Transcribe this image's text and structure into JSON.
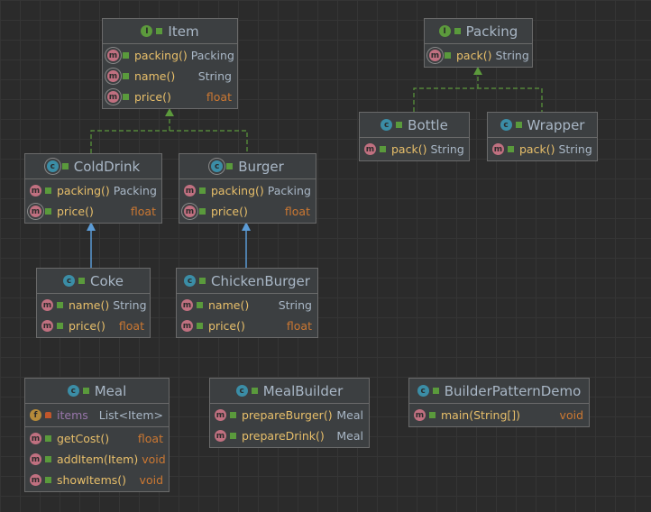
{
  "classes": [
    {
      "id": "item",
      "name": "Item",
      "kind": "I",
      "fields": [],
      "methods": [
        {
          "name": "packing()",
          "type": "Packing",
          "abstract": true
        },
        {
          "name": "name()",
          "type": "String",
          "abstract": true
        },
        {
          "name": "price()",
          "type": "float",
          "abstract": true
        }
      ]
    },
    {
      "id": "packing",
      "name": "Packing",
      "kind": "I",
      "fields": [],
      "methods": [
        {
          "name": "pack()",
          "type": "String",
          "abstract": true
        }
      ]
    },
    {
      "id": "bottle",
      "name": "Bottle",
      "kind": "C",
      "fields": [],
      "methods": [
        {
          "name": "pack()",
          "type": "String"
        }
      ]
    },
    {
      "id": "wrapper",
      "name": "Wrapper",
      "kind": "C",
      "fields": [],
      "methods": [
        {
          "name": "pack()",
          "type": "String"
        }
      ]
    },
    {
      "id": "colddrink",
      "name": "ColdDrink",
      "kind": "C",
      "abstract": true,
      "fields": [],
      "methods": [
        {
          "name": "packing()",
          "type": "Packing"
        },
        {
          "name": "price()",
          "type": "float",
          "abstract": true
        }
      ]
    },
    {
      "id": "burger",
      "name": "Burger",
      "kind": "C",
      "abstract": true,
      "fields": [],
      "methods": [
        {
          "name": "packing()",
          "type": "Packing"
        },
        {
          "name": "price()",
          "type": "float",
          "abstract": true
        }
      ]
    },
    {
      "id": "coke",
      "name": "Coke",
      "kind": "C",
      "fields": [],
      "methods": [
        {
          "name": "name()",
          "type": "String"
        },
        {
          "name": "price()",
          "type": "float"
        }
      ]
    },
    {
      "id": "chickenburger",
      "name": "ChickenBurger",
      "kind": "C",
      "fields": [],
      "methods": [
        {
          "name": "name()",
          "type": "String"
        },
        {
          "name": "price()",
          "type": "float"
        }
      ]
    },
    {
      "id": "meal",
      "name": "Meal",
      "kind": "C",
      "fields": [
        {
          "name": "items",
          "type": "List<Item>",
          "private": true
        }
      ],
      "methods": [
        {
          "name": "getCost()",
          "type": "float"
        },
        {
          "name": "addItem(Item)",
          "type": "void"
        },
        {
          "name": "showItems()",
          "type": "void"
        }
      ]
    },
    {
      "id": "mealbuilder",
      "name": "MealBuilder",
      "kind": "C",
      "fields": [],
      "methods": [
        {
          "name": "prepareBurger()",
          "type": "Meal"
        },
        {
          "name": "prepareDrink()",
          "type": "Meal"
        }
      ]
    },
    {
      "id": "builderpatterndemo",
      "name": "BuilderPatternDemo",
      "kind": "C",
      "main": true,
      "fields": [],
      "methods": [
        {
          "name": "main(String[])",
          "type": "void",
          "static": true
        }
      ]
    }
  ],
  "colors": {
    "implements": "#5c9a3c",
    "extends": "#5b9bd5"
  }
}
